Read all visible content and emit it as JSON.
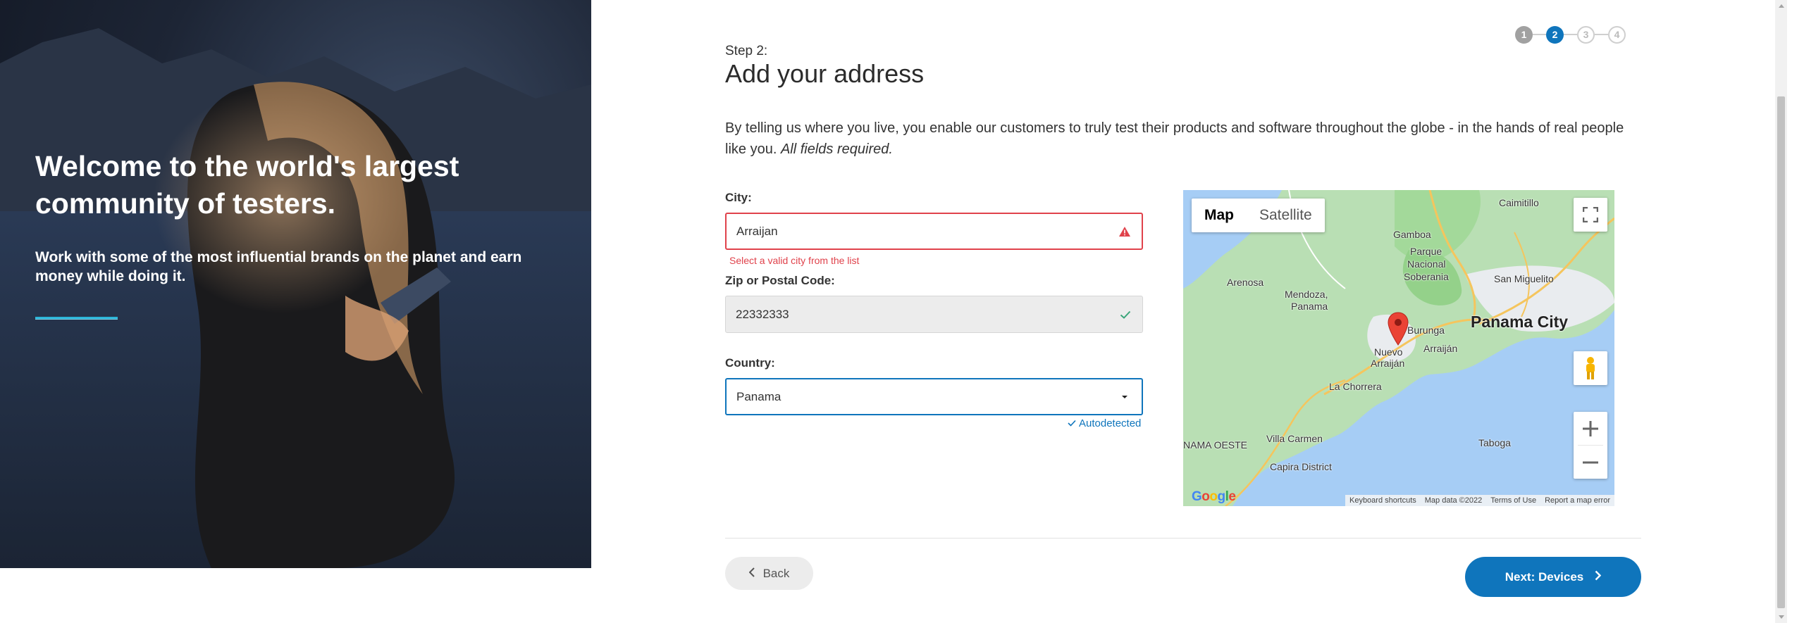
{
  "hero": {
    "title": "Welcome to the world's largest community of testers.",
    "subtitle": "Work with some of the most influential brands on the planet and earn money while doing it."
  },
  "stepper": {
    "steps": [
      "1",
      "2",
      "3",
      "4"
    ],
    "active": 2
  },
  "header": {
    "step_label": "Step 2:",
    "title": "Add your address",
    "intro": "By telling us where you live, you enable our customers to truly test their products and software throughout the globe - in the hands of real people like you.",
    "intro_emphasis": "All fields required."
  },
  "form": {
    "city": {
      "label": "City:",
      "value": "Arraijan",
      "error": "Select a valid city from the list"
    },
    "zip": {
      "label": "Zip or Postal Code:",
      "value": "22332333"
    },
    "country": {
      "label": "Country:",
      "value": "Panama",
      "hint": "Autodetected"
    }
  },
  "map": {
    "tab_map": "Map",
    "tab_satellite": "Satellite",
    "labels": {
      "caimitillo": "Caimitillo",
      "gamboa": "Gamboa",
      "parque": "Parque",
      "nacional": "Nacional",
      "soberania": "Soberania",
      "arenosa": "Arenosa",
      "san_miguelito": "San Miguelito",
      "mendoza": "Mendoza,",
      "mendoza2": "Panama",
      "panama_city": "Panama City",
      "burunga": "Burunga",
      "nuevo": "Nuevo",
      "arraijan_small": "Arraiján",
      "arraijan_right": "Arraiján",
      "la_chorrera": "La Chorrera",
      "panama_oeste": "NAMA OESTE",
      "villa_carmen": "Villa Carmen",
      "taboga": "Taboga",
      "capira": "Capira District"
    },
    "google": "Google",
    "footer": [
      "Keyboard shortcuts",
      "Map data ©2022",
      "Terms of Use",
      "Report a map error"
    ]
  },
  "nav": {
    "back": "Back",
    "next": "Next: Devices"
  },
  "colors": {
    "primary": "#0f75bc",
    "error": "#e0424b",
    "success": "#3aa57a",
    "accent_rule": "#2cb5d8"
  }
}
